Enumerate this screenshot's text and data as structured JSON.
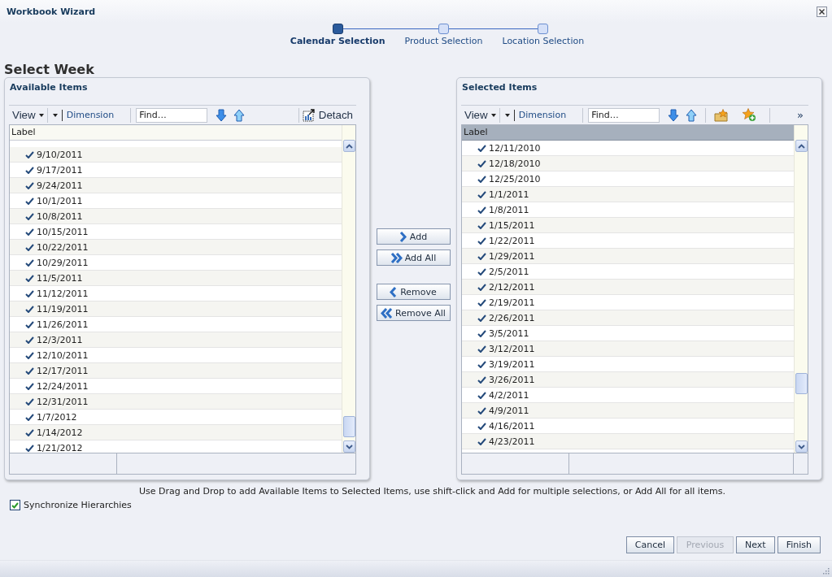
{
  "window": {
    "title": "Workbook Wizard"
  },
  "steps": [
    {
      "label": "Calendar Selection",
      "selected": true
    },
    {
      "label": "Product Selection",
      "selected": false
    },
    {
      "label": "Location Selection",
      "selected": false
    }
  ],
  "heading": "Select Week",
  "panels": [
    {
      "kind": "available",
      "title": "Available Items",
      "toolbar": {
        "view": "View",
        "dimension": "Dimension",
        "find_placeholder": "Find…",
        "detach": "Detach"
      },
      "column": "Label",
      "header_highlighted": false,
      "rows": [
        "9/10/2011",
        "9/17/2011",
        "9/24/2011",
        "10/1/2011",
        "10/8/2011",
        "10/15/2011",
        "10/22/2011",
        "10/29/2011",
        "11/5/2011",
        "11/12/2011",
        "11/19/2011",
        "11/26/2011",
        "12/3/2011",
        "12/10/2011",
        "12/17/2011",
        "12/24/2011",
        "12/31/2011",
        "1/7/2012",
        "1/14/2012",
        "1/21/2012"
      ]
    },
    {
      "kind": "selected",
      "title": "Selected Items",
      "toolbar": {
        "view": "View",
        "dimension": "Dimension",
        "find_placeholder": "Find…",
        "overflow": "»"
      },
      "column": "Label",
      "header_highlighted": true,
      "rows": [
        "12/11/2010",
        "12/18/2010",
        "12/25/2010",
        "1/1/2011",
        "1/8/2011",
        "1/15/2011",
        "1/22/2011",
        "1/29/2011",
        "2/5/2011",
        "2/12/2011",
        "2/19/2011",
        "2/26/2011",
        "3/5/2011",
        "3/12/2011",
        "3/19/2011",
        "3/26/2011",
        "4/2/2011",
        "4/9/2011",
        "4/16/2011",
        "4/23/2011"
      ]
    }
  ],
  "shuttle_buttons": [
    {
      "kind": "add",
      "label": "Add"
    },
    {
      "kind": "add_all",
      "label": "Add All"
    },
    {
      "kind": "remove",
      "label": "Remove"
    },
    {
      "kind": "remove_all",
      "label": "Remove All"
    }
  ],
  "hint": "Use Drag and Drop to add Available Items to Selected Items, use shift-click and Add for multiple selections, or Add All for all items.",
  "synchronize": {
    "label": "Synchronize Hierarchies",
    "checked": true
  },
  "footer_buttons": [
    {
      "label": "Cancel",
      "disabled": false
    },
    {
      "label": "Previous",
      "disabled": true
    },
    {
      "label": "Next",
      "disabled": false
    },
    {
      "label": "Finish",
      "disabled": false
    }
  ]
}
